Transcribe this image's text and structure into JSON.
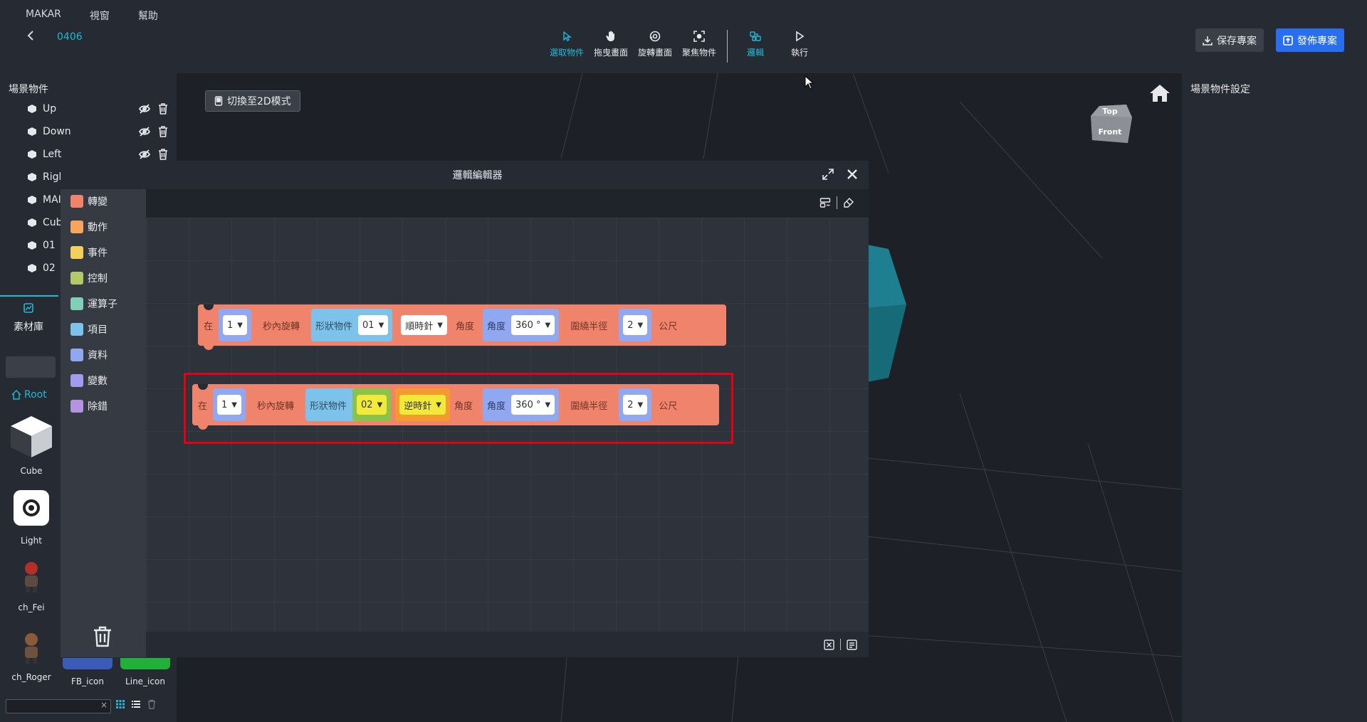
{
  "menu": [
    "MAKAR",
    "視窗",
    "幫助"
  ],
  "project_name": "0406",
  "toolbar": {
    "tools": [
      {
        "label": "選取物件",
        "icon": "cursor-icon",
        "active": true
      },
      {
        "label": "拖曳畫面",
        "icon": "hand-icon",
        "active": false
      },
      {
        "label": "旋轉畫面",
        "icon": "rotate-icon",
        "active": false
      },
      {
        "label": "聚焦物件",
        "icon": "focus-icon",
        "active": false
      },
      {
        "label": "邏輯",
        "icon": "logic-icon",
        "active": true
      },
      {
        "label": "執行",
        "icon": "play-icon",
        "active": false
      }
    ],
    "save_label": "保存專案",
    "publish_label": "發佈專案"
  },
  "scene_panel": {
    "title": "場景物件",
    "objects": [
      {
        "name": "Up",
        "actions": true
      },
      {
        "name": "Down",
        "actions": true
      },
      {
        "name": "Left",
        "actions": true
      },
      {
        "name": "Rigl",
        "actions": false
      },
      {
        "name": "MAI",
        "actions": false
      },
      {
        "name": "Cub",
        "actions": false
      },
      {
        "name": "01",
        "actions": false
      },
      {
        "name": "02",
        "actions": false
      }
    ]
  },
  "library": {
    "tab_label": "素材庫",
    "root_label": "Root",
    "assets": [
      {
        "name": "Cube",
        "icon": "cube-icon"
      },
      {
        "name": "Light",
        "icon": "light-icon"
      },
      {
        "name": "ch_Fei",
        "icon": "character-icon"
      },
      {
        "name": "ch_Roger",
        "icon": "character-icon"
      },
      {
        "name": "FB_icon",
        "icon": "image-icon"
      },
      {
        "name": "Line_icon",
        "icon": "image-icon"
      }
    ],
    "search_clear": "×"
  },
  "viewport": {
    "mode_button": "切換至2D模式",
    "navcube_top": "Top",
    "navcube_front": "Front"
  },
  "right_panel": {
    "title": "場景物件設定"
  },
  "logic_editor": {
    "title": "邏輯編輯器",
    "categories": [
      {
        "label": "轉變",
        "color": "#f0836c"
      },
      {
        "label": "動作",
        "color": "#f5a55e"
      },
      {
        "label": "事件",
        "color": "#f5cf5b"
      },
      {
        "label": "控制",
        "color": "#b5c96a"
      },
      {
        "label": "運算子",
        "color": "#7fcfb9"
      },
      {
        "label": "項目",
        "color": "#7cc2ea"
      },
      {
        "label": "資料",
        "color": "#8fa8ef"
      },
      {
        "label": "變數",
        "color": "#a19cee"
      },
      {
        "label": "除錯",
        "color": "#b494e0"
      }
    ],
    "blocks": [
      {
        "prefix": "在",
        "seconds": "1",
        "rotate_label": "秒內旋轉",
        "object_label": "形狀物件",
        "object": "01",
        "direction": "順時針",
        "angle_label": "角度",
        "angle_inner_label": "角度",
        "angle": "360 °",
        "radius_label": "圍繞半徑",
        "radius": "2",
        "unit": "公尺"
      },
      {
        "prefix": "在",
        "seconds": "1",
        "rotate_label": "秒內旋轉",
        "object_label": "形狀物件",
        "object": "02",
        "direction": "逆時針",
        "angle_label": "角度",
        "angle_inner_label": "角度",
        "angle": "360 °",
        "radius_label": "圍繞半徑",
        "radius": "2",
        "unit": "公尺"
      }
    ]
  }
}
